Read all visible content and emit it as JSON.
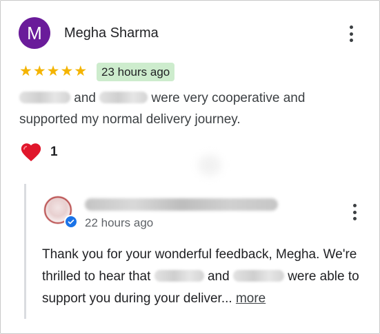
{
  "colors": {
    "avatar_bg": "#6a1b9a",
    "star": "#f4b400",
    "badge_bg": "#cdeccd",
    "heart": "#e0162b",
    "verified": "#1a73e8"
  },
  "review": {
    "avatar_letter": "M",
    "reviewer_name": "Megha Sharma",
    "rating": 5,
    "stars": [
      "★",
      "★",
      "★",
      "★",
      "★"
    ],
    "time_ago": "23 hours ago",
    "text_part1": "and",
    "text_part2": "were very cooperative and supported my normal delivery journey.",
    "like_count": "1",
    "like_icon": "heart-icon",
    "menu_icon": "more-vert-icon"
  },
  "reply": {
    "time_ago": "22 hours ago",
    "verified_icon": "verified-check-icon",
    "menu_icon": "more-vert-icon",
    "text_part1": "Thank you for your wonderful feedback, Megha. We're thrilled to hear that",
    "text_part2": "and",
    "text_part3": "were able to support you during your deliver...",
    "more_label": "more"
  }
}
